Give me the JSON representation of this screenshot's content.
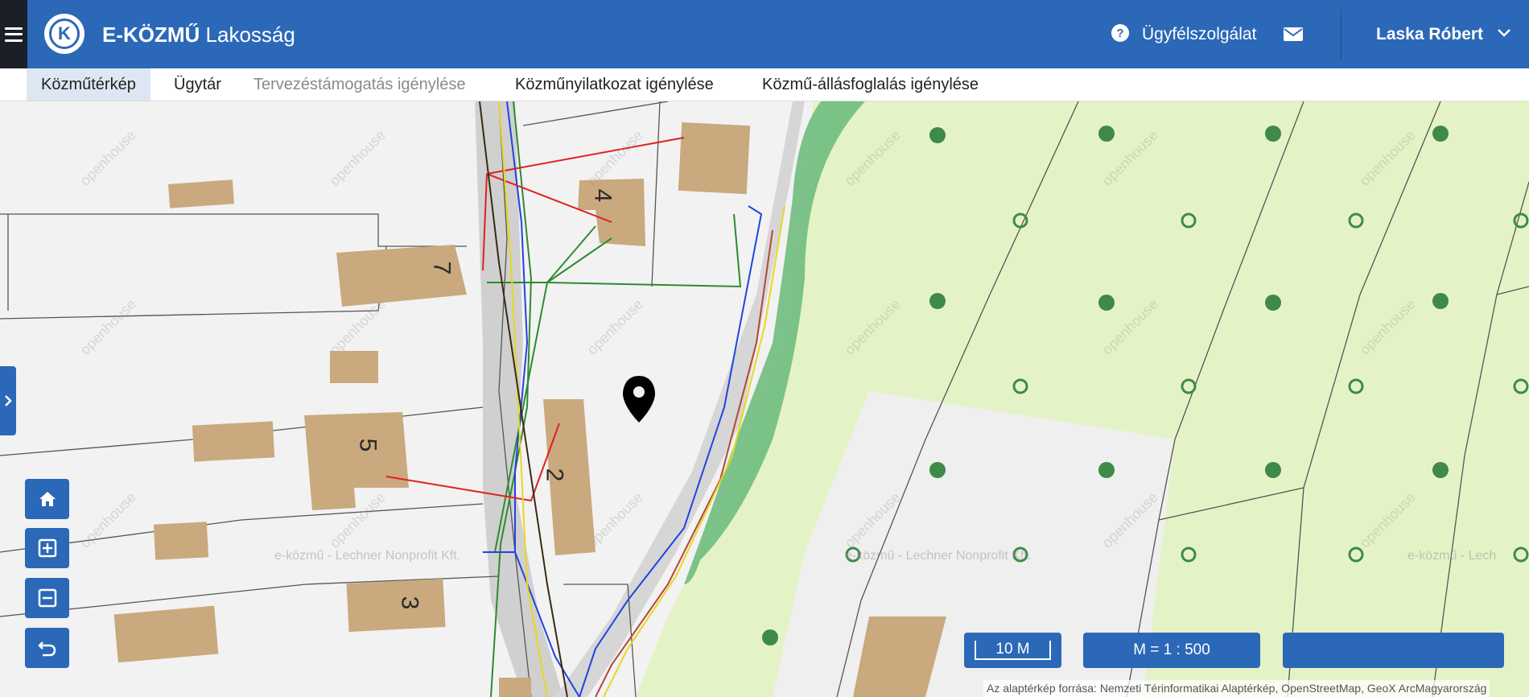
{
  "header": {
    "app_brand": "E-KÖZMŰ",
    "app_suffix": " Lakosság",
    "logo_letter": "K",
    "help_glyph": "?",
    "support_label": "Ügyfélszolgálat",
    "user_name": "Laska Róbert",
    "accent_color": "#2b68b8"
  },
  "tabs": [
    {
      "label": "Közműtérkép",
      "active": true
    },
    {
      "label": "Ügytár"
    },
    {
      "label": "Tervezéstámogatás igénylése",
      "disabled": true
    },
    {
      "label": "Közműnyilatkozat igénylése"
    },
    {
      "label": "Közmű-állásfoglalás igénylése"
    }
  ],
  "map": {
    "house_numbers": [
      "7",
      "4",
      "5",
      "2",
      "3"
    ],
    "watermark_text": "openhouse",
    "provider_watermark": "e-közmű - Lechner Nonprofit Kft.",
    "provider_watermark_partial": "e-közmű - Lech",
    "scale_bar_label": "10 M",
    "scale_ratio_label": "M = 1 : 500",
    "attribution": "Az alaptérkép forrása: Nemzeti Térinformatikai Alaptérkép, OpenStreetMap, GeoX ArcMagyarország"
  },
  "icons": {
    "menu": "hamburger-icon",
    "help": "help-icon",
    "mail": "mail-icon",
    "chevron": "chevron-down-icon",
    "home": "home-icon",
    "zoom_in": "zoom-in-icon",
    "zoom_out": "zoom-out-icon",
    "back": "undo-icon",
    "pin": "location-pin-icon"
  }
}
